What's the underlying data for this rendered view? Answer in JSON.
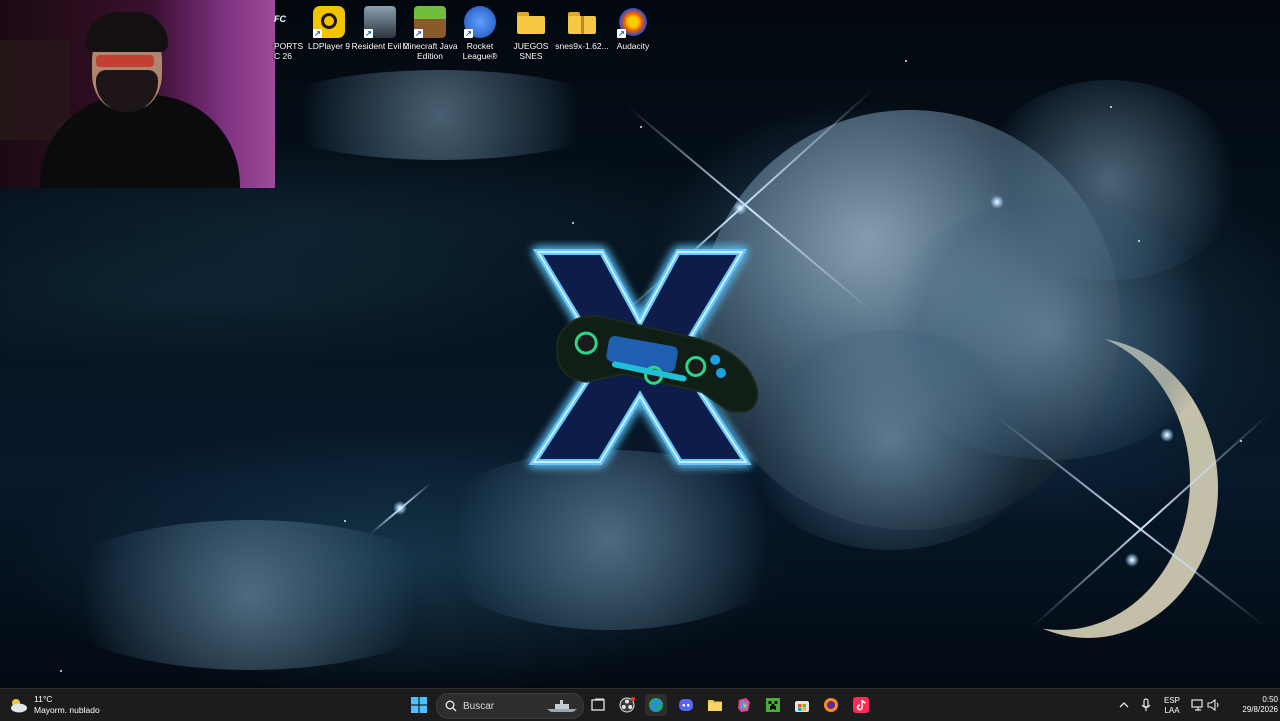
{
  "desktop": {
    "icons": [
      {
        "id": "ea-sports",
        "label": "PORTS\nC 26",
        "color": "#ffffff"
      },
      {
        "id": "ldplayer",
        "label": "LDPlayer 9",
        "color": "#f2c500"
      },
      {
        "id": "resident-evil",
        "label": "Resident Evil 2",
        "color": "#5a6b7a"
      },
      {
        "id": "minecraft",
        "label": "Minecraft Java Edition",
        "color": "#4b8b2a"
      },
      {
        "id": "rocket-league",
        "label": "Rocket League®",
        "color": "#3a6fd8"
      },
      {
        "id": "juegos-snes",
        "label": "JUEGOS SNES",
        "color": "#f3c33b"
      },
      {
        "id": "snes9x",
        "label": "snes9x-1.62...",
        "color": "#f3c33b"
      },
      {
        "id": "audacity",
        "label": "Audacity",
        "color": "#1f4dd6"
      }
    ]
  },
  "taskbar": {
    "weather": {
      "temp": "11°C",
      "desc": "Mayorm. nublado"
    },
    "search_placeholder": "Buscar",
    "tray": {
      "lang_top": "ESP",
      "lang_bottom": "LAA",
      "time": "0:50",
      "date": "29/8/2026"
    },
    "accent": "#0078d4"
  }
}
